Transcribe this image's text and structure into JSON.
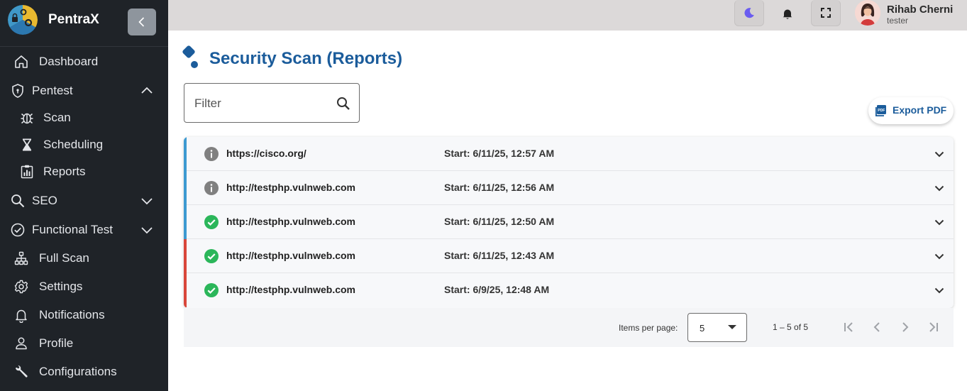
{
  "app": {
    "name": "PentraX"
  },
  "sidebar": {
    "items": [
      {
        "label": "Dashboard",
        "icon": "home-icon"
      },
      {
        "label": "Pentest",
        "icon": "shield-icon",
        "expanded": true,
        "children": [
          {
            "label": "Scan",
            "icon": "bug-icon"
          },
          {
            "label": "Scheduling",
            "icon": "hourglass-icon"
          },
          {
            "label": "Reports",
            "icon": "report-chart-icon"
          }
        ]
      },
      {
        "label": "SEO",
        "icon": "search-icon",
        "expanded": false
      },
      {
        "label": "Functional Test",
        "icon": "check-circle-icon",
        "expanded": false
      },
      {
        "label": "Full Scan",
        "icon": "sitemap-icon"
      },
      {
        "label": "Settings",
        "icon": "gear-icon"
      },
      {
        "label": "Notifications",
        "icon": "bell-icon"
      },
      {
        "label": "Profile",
        "icon": "user-icon"
      },
      {
        "label": "Configurations",
        "icon": "wrench-icon"
      }
    ]
  },
  "topbar": {
    "user": {
      "name": "Rihab Cherni",
      "role": "tester"
    },
    "icons": [
      "moon-icon",
      "bell-icon",
      "fullscreen-icon"
    ]
  },
  "main": {
    "title": "Security Scan (Reports)",
    "filter": {
      "placeholder": "Filter",
      "value": ""
    },
    "export_label": "Export PDF",
    "reports": [
      {
        "url": "https://cisco.org/",
        "start": "Start: 6/11/25, 12:57 AM",
        "status": "info",
        "bar_color": "#3d9ad1"
      },
      {
        "url": "http://testphp.vulnweb.com",
        "start": "Start: 6/11/25, 12:56 AM",
        "status": "info",
        "bar_color": "#3d9ad1"
      },
      {
        "url": "http://testphp.vulnweb.com",
        "start": "Start: 6/11/25, 12:50 AM",
        "status": "success",
        "bar_color": "#3d9ad1"
      },
      {
        "url": "http://testphp.vulnweb.com",
        "start": "Start: 6/11/25, 12:43 AM",
        "status": "success",
        "bar_color": "#d9473a"
      },
      {
        "url": "http://testphp.vulnweb.com",
        "start": "Start: 6/9/25, 12:48 AM",
        "status": "success",
        "bar_color": "#d9473a"
      }
    ],
    "paginator": {
      "items_per_page_label": "Items per page:",
      "items_per_page": "5",
      "range": "1 – 5 of 5"
    }
  },
  "colors": {
    "sidebar_bg": "#1f2328",
    "accent": "#1b5c9b",
    "success": "#2bb65a",
    "info": "#808080"
  }
}
